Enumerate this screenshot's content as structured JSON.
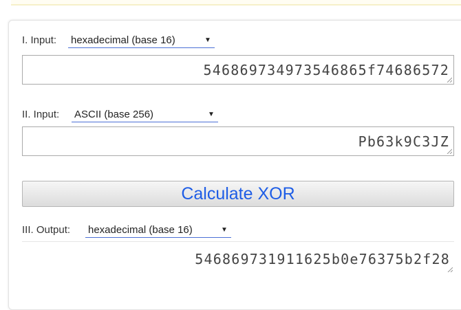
{
  "input1": {
    "label": "I. Input:",
    "selected_format": "hexadecimal (base 16)",
    "value": "546869734973546865f74686572"
  },
  "input2": {
    "label": "II. Input:",
    "selected_format": "ASCII (base 256)",
    "value": "Pb63k9C3JZ"
  },
  "calculate_button": {
    "label": "Calculate XOR"
  },
  "output": {
    "label": "III. Output:",
    "selected_format": "hexadecimal (base 16)",
    "value": "546869731911625b0e76375b2f28"
  },
  "icons": {
    "dropdown": "triangle-down",
    "resize": "resize-grip"
  },
  "colors": {
    "accent": "#1e5de6",
    "select_underline": "#4a6fd6"
  }
}
